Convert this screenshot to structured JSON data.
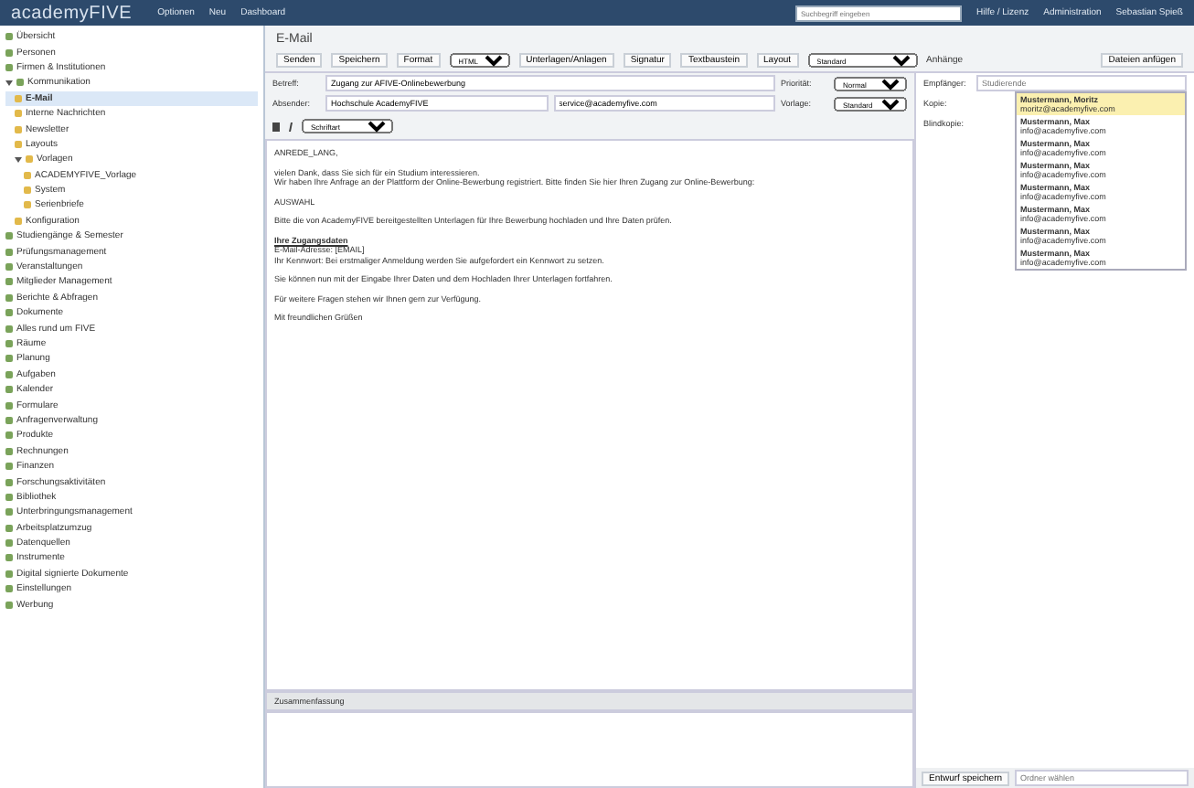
{
  "header": {
    "logo": "academyFIVE",
    "menu": [
      "Optionen",
      "Neu",
      "Dashboard"
    ],
    "search": {
      "placeholder": "Suchbegriff eingeben"
    },
    "right": [
      "Hilfe / Lizenz",
      "Administration",
      "Sebastian Spieß"
    ]
  },
  "sidebar": {
    "items": [
      {
        "label": "Übersicht"
      },
      {
        "label": "Personen"
      },
      {
        "label": "Firmen & Institutionen"
      },
      {
        "label": "Kommunikation",
        "expanded": true,
        "children": [
          {
            "label": "E-Mail",
            "selected": true
          },
          {
            "label": "Interne Nachrichten",
            "selected": false
          },
          {
            "label": "Newsletter",
            "selected": false
          },
          {
            "label": "Layouts",
            "selected": false
          },
          {
            "label": "Vorlagen",
            "selected": false,
            "expanded": true,
            "children": [
              {
                "label": "ACADEMYFIVE_Vorlage",
                "selected": false
              },
              {
                "label": "System",
                "selected": false
              },
              {
                "label": "Serienbriefe",
                "selected": false
              }
            ]
          },
          {
            "label": "Konfiguration",
            "selected": false
          }
        ]
      },
      {
        "label": "Studiengänge & Semester"
      },
      {
        "label": "Prüfungsmanagement"
      },
      {
        "label": "Veranstaltungen"
      },
      {
        "label": "Mitglieder Management"
      },
      {
        "label": "Berichte & Abfragen"
      },
      {
        "label": "Dokumente"
      },
      {
        "label": "Alles rund um FIVE"
      },
      {
        "label": "Räume"
      },
      {
        "label": "Planung"
      },
      {
        "label": "Aufgaben"
      },
      {
        "label": "Kalender"
      },
      {
        "label": "Formulare"
      },
      {
        "label": "Anfragenverwaltung"
      },
      {
        "label": "Produkte"
      },
      {
        "label": "Rechnungen"
      },
      {
        "label": "Finanzen"
      },
      {
        "label": "Forschungsaktivitäten"
      },
      {
        "label": "Bibliothek"
      },
      {
        "label": "Unterbringungsmanagement"
      },
      {
        "label": "Arbeitsplatzumzug"
      },
      {
        "label": "Datenquellen"
      },
      {
        "label": "Instrumente"
      },
      {
        "label": "Digital signierte Dokumente"
      },
      {
        "label": "Einstellungen"
      },
      {
        "label": "Werbung"
      }
    ]
  },
  "page": {
    "title": "E-Mail",
    "toolbar": [
      "Senden",
      "Speichern",
      "Format"
    ],
    "format_value": "HTML",
    "toolbar2": [
      "Unterlagen/Anlagen",
      "Signatur",
      "Textbaustein",
      "Layout"
    ],
    "layout_value": "Standard",
    "attach_label": "Anhänge",
    "attach_button": "Dateien anfügen",
    "fields": [
      {
        "label": "Betreff:",
        "value": "Zugang zur AFIVE-Onlinebewerbung",
        "extra_label": "Priorität:",
        "extra_value": "Normal"
      },
      {
        "label": "Absender:",
        "value": "Hochschule AcademyFIVE",
        "value2": "service@academyfive.com",
        "extra_label": "Vorlage:",
        "extra_value": "Standard"
      }
    ],
    "recipient": {
      "label": "Empfänger:",
      "placeholder": "Studierende",
      "cc_label": "Kopie:",
      "bcc_label": "Blindkopie:"
    },
    "suggestions": [
      {
        "name": "Mustermann, Moritz",
        "email": "moritz@academyfive.com",
        "selected": true
      },
      {
        "name": "Mustermann, Max",
        "email": "info@academyfive.com",
        "selected": false
      },
      {
        "name": "Mustermann, Max",
        "email": "info@academyfive.com",
        "selected": false
      },
      {
        "name": "Mustermann, Max",
        "email": "info@academyfive.com",
        "selected": false
      },
      {
        "name": "Mustermann, Max",
        "email": "info@academyfive.com",
        "selected": false
      },
      {
        "name": "Mustermann, Max",
        "email": "info@academyfive.com",
        "selected": false
      },
      {
        "name": "Mustermann, Max",
        "email": "info@academyfive.com",
        "selected": false
      },
      {
        "name": "Mustermann, Max",
        "email": "info@academyfive.com",
        "selected": false
      }
    ],
    "font_select": "Schriftart",
    "body": [
      {
        "kind": "text",
        "text": "ANREDE_LANG,"
      },
      {
        "kind": "text",
        "text": "vielen Dank, dass Sie sich für ein Studium interessieren.\nWir haben Ihre Anfrage an der Plattform der Online-Bewerbung registriert. Bitte finden Sie hier Ihren Zugang zur Online-Bewerbung:"
      },
      {
        "kind": "text",
        "text": "AUSWAHL"
      },
      {
        "kind": "text",
        "text": "Bitte die von AcademyFIVE bereitgestellten Unterlagen für Ihre Bewerbung hochladen und Ihre Daten prüfen."
      },
      {
        "kind": "heading",
        "text": "Ihre Zugangsdaten",
        "lines": [
          "E-Mail-Adresse: [EMAIL]",
          "Ihr Kennwort: Bei erstmaliger Anmeldung werden Sie aufgefordert ein Kennwort zu setzen."
        ]
      },
      {
        "kind": "text",
        "text": "Sie können nun mit der Eingabe Ihrer Daten und dem Hochladen Ihrer Unterlagen fortfahren."
      },
      {
        "kind": "text",
        "text": "Für weitere Fragen stehen wir Ihnen gern zur Verfügung."
      },
      {
        "kind": "text",
        "text": "Mit freundlichen Grüßen"
      }
    ],
    "comment_label": "Zusammenfassung",
    "footer": {
      "button": "Entwurf speichern",
      "field_placeholder": "Ordner wählen"
    }
  }
}
